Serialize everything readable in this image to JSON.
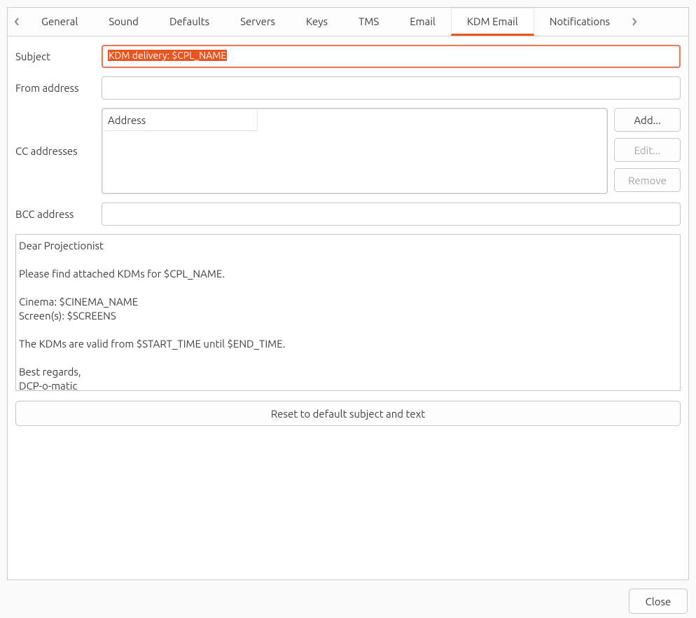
{
  "tabs": {
    "items": [
      {
        "label": "General"
      },
      {
        "label": "Sound"
      },
      {
        "label": "Defaults"
      },
      {
        "label": "Servers"
      },
      {
        "label": "Keys"
      },
      {
        "label": "TMS"
      },
      {
        "label": "Email"
      },
      {
        "label": "KDM Email"
      },
      {
        "label": "Notifications"
      }
    ],
    "active_index": 7
  },
  "form": {
    "subject": {
      "label": "Subject",
      "value": "KDM delivery: $CPL_NAME"
    },
    "from": {
      "label": "From address",
      "value": ""
    },
    "cc": {
      "label": "CC addresses",
      "header": "Address",
      "rows": [],
      "buttons": {
        "add": "Add...",
        "edit": "Edit...",
        "remove": "Remove"
      }
    },
    "bcc": {
      "label": "BCC address",
      "value": ""
    },
    "body": "Dear Projectionist\n\nPlease find attached KDMs for $CPL_NAME.\n\nCinema: $CINEMA_NAME\nScreen(s): $SCREENS\n\nThe KDMs are valid from $START_TIME until $END_TIME.\n\nBest regards,\nDCP-o-matic",
    "reset_label": "Reset to default subject and text"
  },
  "footer": {
    "close": "Close"
  }
}
